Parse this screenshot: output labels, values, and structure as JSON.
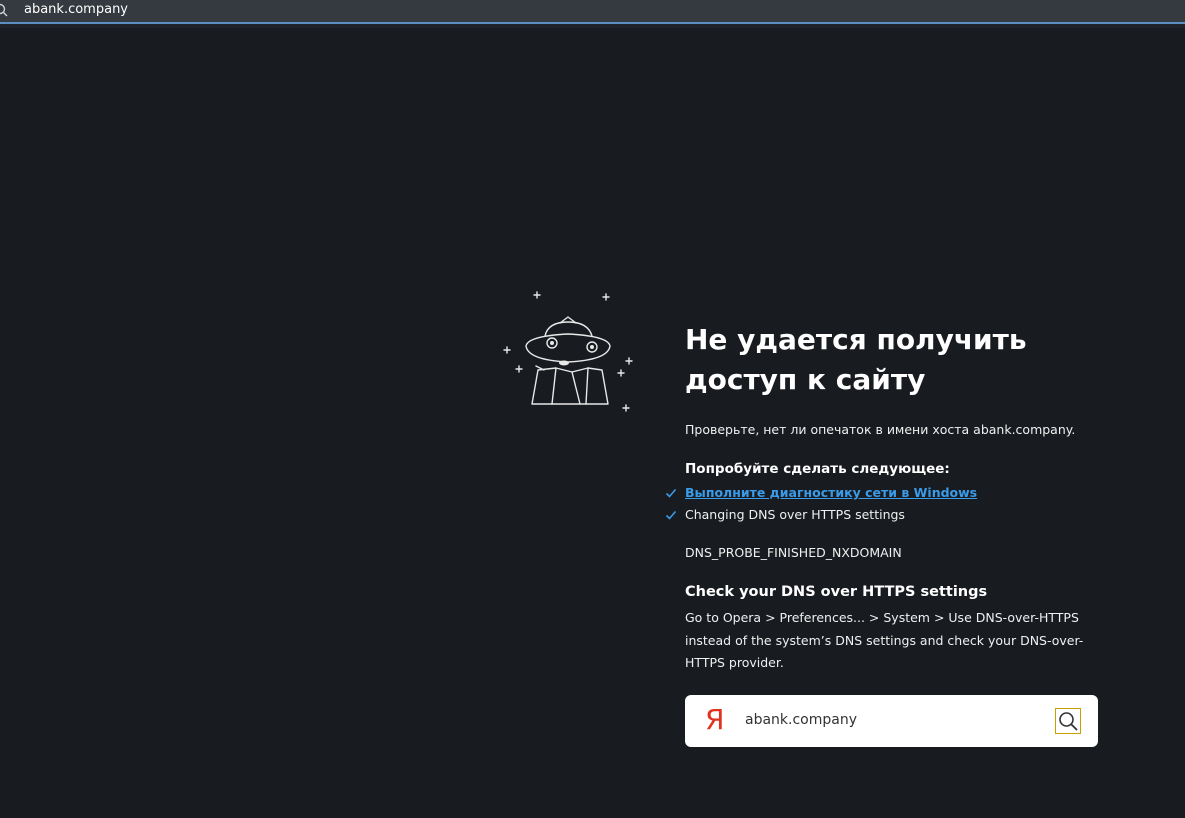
{
  "address_bar": {
    "value": "abank.company",
    "icon": "search-icon"
  },
  "illustration": {
    "icon": "ufo-icon"
  },
  "error": {
    "title_line1": "Не удается получить",
    "title_line2": "доступ к сайту",
    "hint": "Проверьте, нет ли опечаток в имени хоста abank.company.",
    "try_heading": "Попробуйте сделать следующее:",
    "suggestions": [
      {
        "label": "Выполните диагностику сети в Windows",
        "icon": "check-icon"
      },
      {
        "label": "Changing DNS over HTTPS settings",
        "icon": "check-icon"
      }
    ],
    "code": "DNS_PROBE_FINISHED_NXDOMAIN",
    "dns_heading": "Check your DNS over HTTPS settings",
    "dns_body": "Go to Opera > Preferences... > System > Use DNS-over-HTTPS instead of the system’s DNS settings and check your DNS-over-HTTPS provider."
  },
  "search": {
    "logo": "Я",
    "query": "abank.company",
    "button_icon": "magnifier-icon"
  },
  "colors": {
    "background": "#181b20",
    "link": "#3a9be8",
    "check": "#3a9be8",
    "yandex_red": "#e0311f",
    "search_button_border": "#c8a000"
  }
}
